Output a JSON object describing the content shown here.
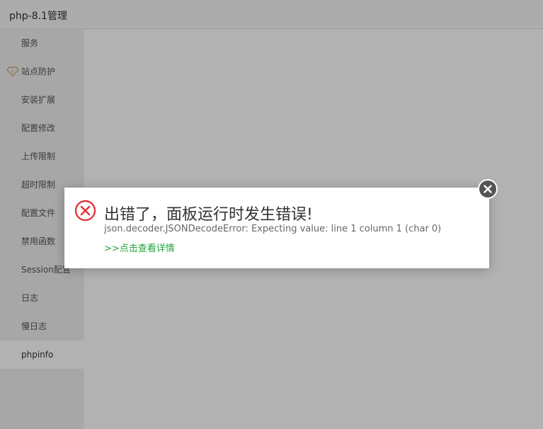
{
  "window": {
    "title": "php-8.1管理"
  },
  "sidebar": {
    "items": [
      {
        "label": "服务"
      },
      {
        "label": "站点防护",
        "icon": "vip-diamond-icon"
      },
      {
        "label": "安装扩展"
      },
      {
        "label": "配置修改"
      },
      {
        "label": "上传限制"
      },
      {
        "label": "超时限制"
      },
      {
        "label": "配置文件"
      },
      {
        "label": "禁用函数"
      },
      {
        "label": "Session配置"
      },
      {
        "label": "日志"
      },
      {
        "label": "慢日志"
      },
      {
        "label": "phpinfo",
        "active": true
      }
    ]
  },
  "dialog": {
    "icon": "error-circle-icon",
    "title": "出错了，面板运行时发生错误!",
    "message": "json.decoder.JSONDecodeError: Expecting value: line 1 column 1 (char 0)",
    "link_label": ">>点击查看详情",
    "close_icon": "close-icon"
  },
  "colors": {
    "accent": "#20a53a",
    "error": "#e0383b",
    "vip": "#c8a264",
    "close_button_bg": "#555555"
  }
}
